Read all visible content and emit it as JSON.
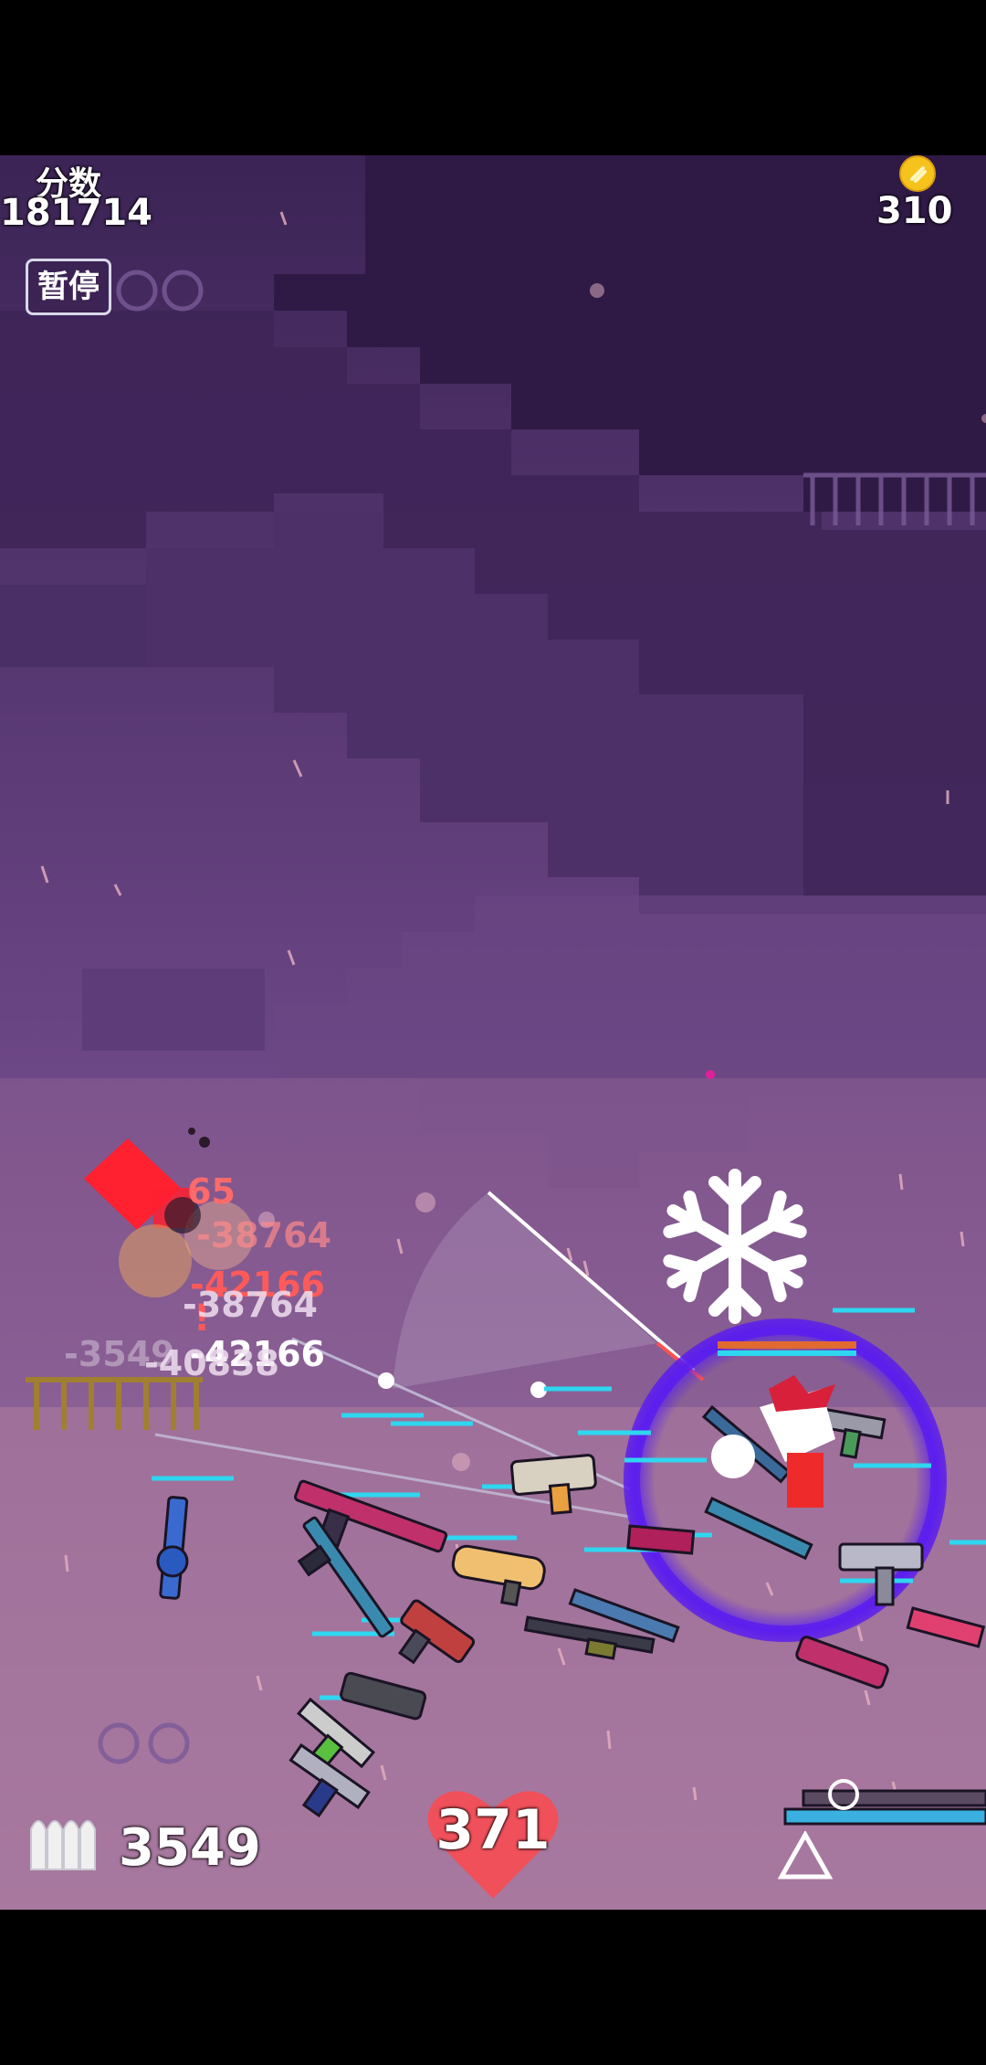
{
  "hud": {
    "score_label": "分数",
    "score_value": "181714",
    "coin_value": "310",
    "pause_label": "暂停",
    "ammo_value": "3549",
    "health_value": "371"
  },
  "damage_numbers": [
    "-42166",
    "-38764",
    "-42166",
    "-40838",
    "-38764",
    "-3549",
    "65"
  ],
  "alert_mark": "!",
  "icons": [
    "coin-icon",
    "bullets-icon",
    "heart-icon",
    "snowflake-icon",
    "triangle-icon",
    "circle-icon"
  ],
  "colors": {
    "sky": "#4a2a6a",
    "ground": "#9a6a9a",
    "health": "#f0505a",
    "coin": "#f6c31c",
    "freeze_ring": "#5a1cf0",
    "enemy_hp": "#2fd6f0",
    "damage_red": "#ff5a5a"
  }
}
